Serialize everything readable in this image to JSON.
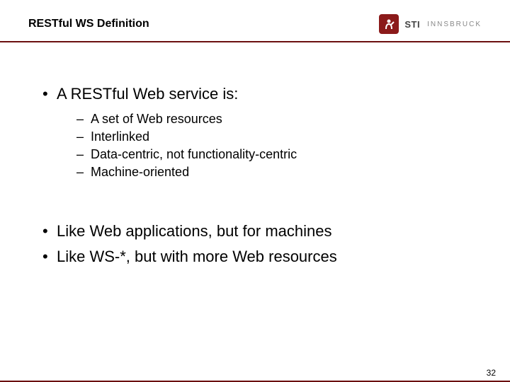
{
  "header": {
    "title": "RESTful WS Definition",
    "logo": {
      "primary": "STI",
      "secondary": "INNSBRUCK"
    }
  },
  "content": {
    "main1": {
      "text": "A RESTful Web service is:",
      "subs": [
        "A set of Web resources",
        "Interlinked",
        "Data-centric, not functionality-centric",
        "Machine-oriented"
      ]
    },
    "main2": {
      "text": "Like Web applications, but for machines"
    },
    "main3": {
      "text": "Like WS-*, but with more Web resources"
    }
  },
  "footer": {
    "page": "32"
  }
}
